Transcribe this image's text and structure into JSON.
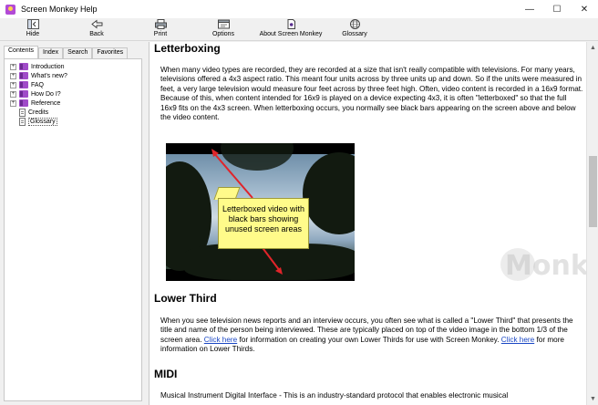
{
  "window": {
    "title": "Screen Monkey Help",
    "controls": [
      "—",
      "☐",
      "✕"
    ]
  },
  "toolbar": {
    "hide": "Hide",
    "back": "Back",
    "print": "Print",
    "options": "Options",
    "about": "About Screen Monkey",
    "glossary": "Glossary"
  },
  "tabs": [
    "Contents",
    "Index",
    "Search",
    "Favorites"
  ],
  "tree": [
    {
      "label": "Introduction",
      "type": "book"
    },
    {
      "label": "What's new?",
      "type": "book"
    },
    {
      "label": "FAQ",
      "type": "book"
    },
    {
      "label": "How Do I?",
      "type": "book"
    },
    {
      "label": "Reference",
      "type": "book"
    },
    {
      "label": "Credits",
      "type": "page"
    },
    {
      "label": "Glossary",
      "type": "page"
    }
  ],
  "content": {
    "letterboxing_title": "Letterboxing",
    "letterboxing_text": "When many video types are recorded, they are recorded at a size that isn't really compatible with televisions. For many years, televisions offered a 4x3 aspect ratio. This meant four units across by three units up and down. So if the units were measured in feet, a very large television would measure four feet across by three feet high. Often, video content is recorded in a 16x9 format. Because of this, when content intended for 16x9 is played on a device expecting 4x3, it is often \"letterboxed\" so that the full 16x9 fits on the 4x3 screen. When letterboxing occurs, you normally see black bars appearing on the screen above and below the video content.",
    "callout_text": "Letterboxed video with black bars showing unused screen areas",
    "lower_third_title": "Lower Third",
    "lower_third_text_1": "When you see television news reports and an interview occurs, you often see what is called a \"Lower Third\" that presents the title and name of the person being interviewed. These are typically placed on top of the video image in the bottom 1/3 of the screen area.",
    "click_here": "Click here",
    "lower_third_text_2": "for information on creating your own Lower Thirds for use with Screen Monkey.",
    "lower_third_text_3": "for more information on Lower Thirds.",
    "midi_title": "MIDI",
    "midi_text": "Musical Instrument Digital Interface - This is an industry-standard protocol that enables electronic musical",
    "watermark": "Monkey"
  },
  "colors": {
    "link": "#1a47c4",
    "callout": "#fffb8a",
    "arrow": "#e0242a"
  }
}
